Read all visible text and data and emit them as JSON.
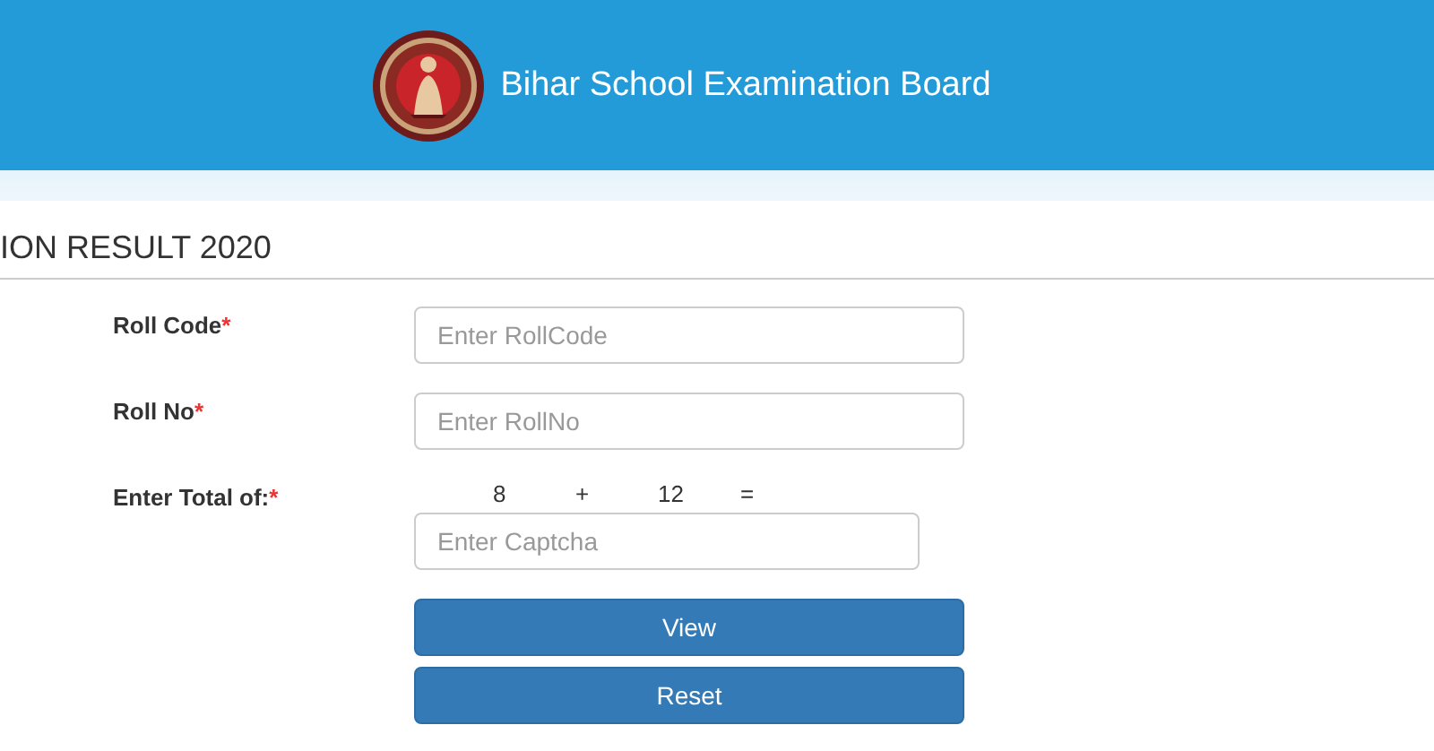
{
  "header": {
    "title": "Bihar School Examination Board"
  },
  "page_title": "ION RESULT 2020",
  "fields": [
    {
      "kind": "text",
      "label": "Roll Code",
      "mark": "*",
      "placeholder": "Enter RollCode"
    },
    {
      "kind": "text",
      "label": "Roll No",
      "mark": "*",
      "placeholder": "Enter RollNo"
    },
    {
      "kind": "captcha",
      "label": "Enter Total of:",
      "mark": "*",
      "captcha": [
        "8",
        "+",
        "12",
        "="
      ],
      "placeholder": "Enter Captcha"
    }
  ],
  "buttons": [
    "View",
    "Reset"
  ]
}
